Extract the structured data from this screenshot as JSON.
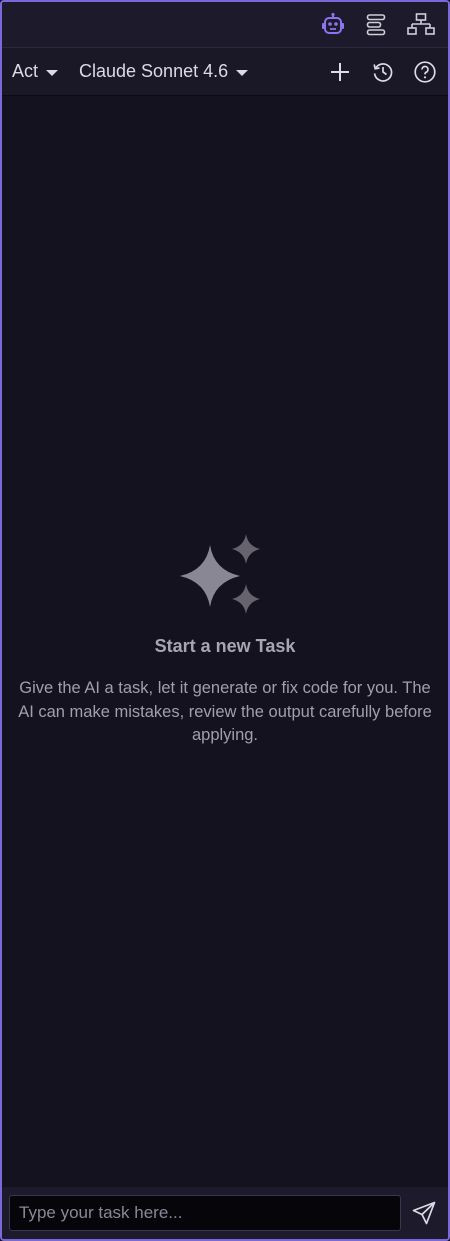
{
  "header": {
    "icons": [
      "robot-icon",
      "list-icon",
      "sitemap-icon"
    ],
    "accent_color": "#8b74f0"
  },
  "toolbar": {
    "mode_label": "Act",
    "model_label": "Claude Sonnet 4.6",
    "icons": [
      "plus-icon",
      "history-icon",
      "help-icon"
    ]
  },
  "empty_state": {
    "icon": "sparkles-icon",
    "title": "Start a new Task",
    "description": "Give the AI a task, let it generate or fix code for you. The AI can make mistakes, review the output carefully before applying."
  },
  "composer": {
    "placeholder": "Type your task here...",
    "value": "",
    "send_icon": "send-icon"
  },
  "colors": {
    "frame_border": "#7b68d9",
    "background": "#15121f",
    "header_background": "#1d1a2b"
  }
}
